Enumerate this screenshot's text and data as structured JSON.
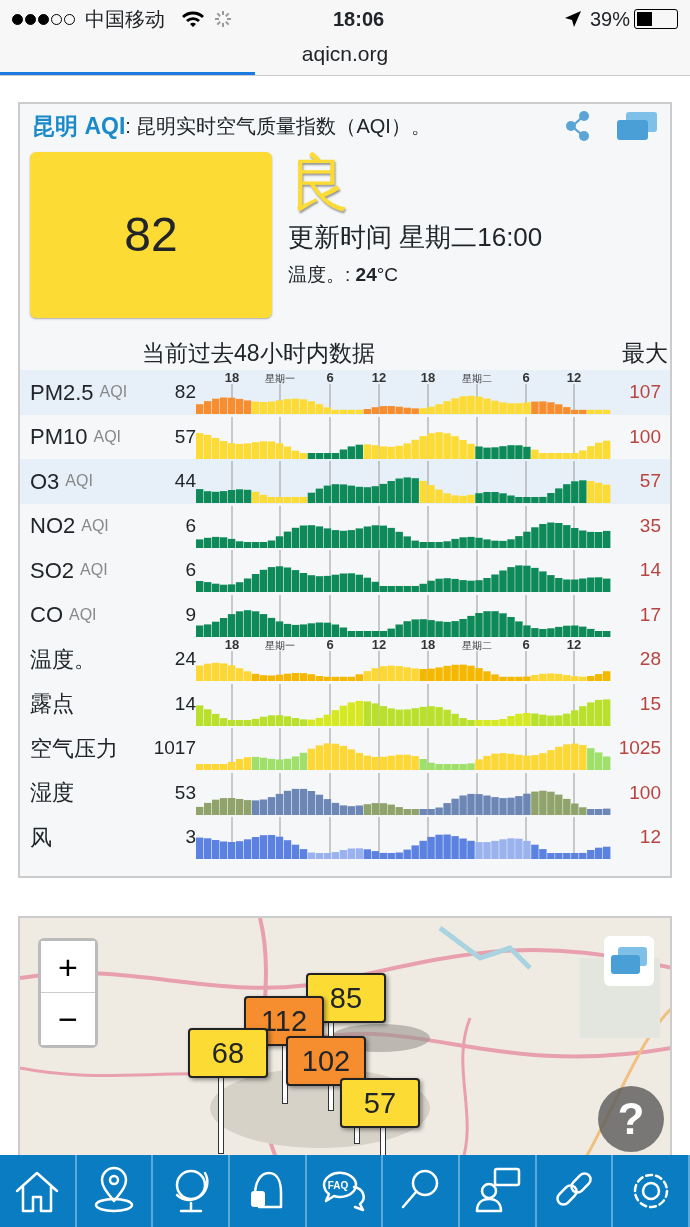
{
  "status_bar": {
    "signal_dots": [
      {
        "filled": true
      },
      {
        "filled": true
      },
      {
        "filled": true
      },
      {
        "filled": false
      },
      {
        "filled": false
      }
    ],
    "carrier": "中国移动",
    "time": "18:06",
    "battery_text": "39%",
    "battery": {
      "level": 0.39
    }
  },
  "address_bar": {
    "url": "aqicn.org",
    "progress": {
      "level": 0.37
    }
  },
  "header": {
    "city_aqi": "昆明 AQI",
    "title": ": 昆明实时空气质量指数（AQI）。"
  },
  "summary": {
    "aqi": "82",
    "level": "良",
    "updated": "更新时间 星期二16:00",
    "temperature": "温度。: **24**°C"
  },
  "table": {
    "heading": "当前过去48小时内数据",
    "max_heading": "最大",
    "rows": [
      {
        "name": "PM2.5",
        "unit": "AQI",
        "current": "82",
        "max": "107",
        "highlighted": true,
        "axis_labels": [
          "18",
          "星期一",
          "6",
          "12",
          "18",
          "星期二",
          "6",
          "12"
        ]
      },
      {
        "name": "PM10",
        "unit": "AQI",
        "current": "57",
        "max": "100",
        "highlighted": false
      },
      {
        "name": "O3",
        "unit": "AQI",
        "current": "44",
        "max": "57",
        "highlighted": true
      },
      {
        "name": "NO2",
        "unit": "AQI",
        "current": "6",
        "max": "35",
        "highlighted": false
      },
      {
        "name": "SO2",
        "unit": "AQI",
        "current": "6",
        "max": "14",
        "highlighted": false
      },
      {
        "name": "CO",
        "unit": "AQI",
        "current": "9",
        "max": "17",
        "highlighted": false
      },
      {
        "name": "温度。",
        "current": "24",
        "max": "28",
        "highlighted": false,
        "axis_labels": [
          "18",
          "星期一",
          "6",
          "12",
          "18",
          "星期二",
          "6",
          "12"
        ]
      },
      {
        "name": "露点",
        "current": "14",
        "max": "15",
        "highlighted": false
      },
      {
        "name": "空气压力",
        "current": "1017",
        "max": "1025",
        "highlighted": false
      },
      {
        "name": "湿度",
        "current": "53",
        "max": "100",
        "highlighted": false
      },
      {
        "name": "风",
        "current": "3",
        "max": "12",
        "highlighted": false
      }
    ]
  },
  "map": {
    "zoom_in": "+",
    "zoom_out": "−",
    "help": "?",
    "markers": [
      {
        "value": "85",
        "color": "#fddb35"
      },
      {
        "value": "112",
        "color": "#f68e2f"
      },
      {
        "value": "68",
        "color": "#fddb35"
      },
      {
        "value": "102",
        "color": "#f68e2f"
      },
      {
        "value": "57",
        "color": "#fddb35"
      }
    ]
  },
  "nav": [
    {
      "kind": "home"
    },
    {
      "kind": "location"
    },
    {
      "kind": "globe"
    },
    {
      "kind": "mask"
    },
    {
      "kind": "faq",
      "label": "FAQ"
    },
    {
      "kind": "search"
    },
    {
      "kind": "chat"
    },
    {
      "kind": "link"
    },
    {
      "kind": "settings"
    }
  ]
}
